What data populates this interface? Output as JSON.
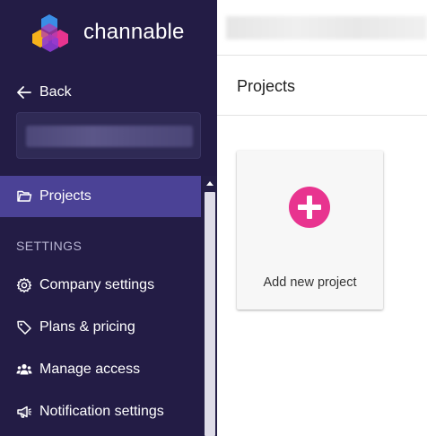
{
  "brand": {
    "name": "channable",
    "logo_colors": [
      "#3a8ee6",
      "#f6b21b",
      "#e8348f",
      "#8e3bd4"
    ]
  },
  "sidebar": {
    "back_label": "Back",
    "account_name": "",
    "items": [
      {
        "label": "Projects",
        "icon": "folder-icon",
        "active": true
      }
    ],
    "settings_heading": "SETTINGS",
    "settings_items": [
      {
        "label": "Company settings",
        "icon": "gear-icon"
      },
      {
        "label": "Plans & pricing",
        "icon": "tag-icon"
      },
      {
        "label": "Manage access",
        "icon": "users-icon"
      },
      {
        "label": "Notification settings",
        "icon": "megaphone-icon"
      }
    ]
  },
  "main": {
    "topbar_text": "",
    "page_title": "Projects",
    "new_project_card": {
      "label": "Add new project",
      "icon": "plus-circle-icon"
    }
  },
  "colors": {
    "sidebar_bg": "#231c45",
    "active_item_bg": "#4b4296",
    "accent_pink": "#e8348f"
  }
}
